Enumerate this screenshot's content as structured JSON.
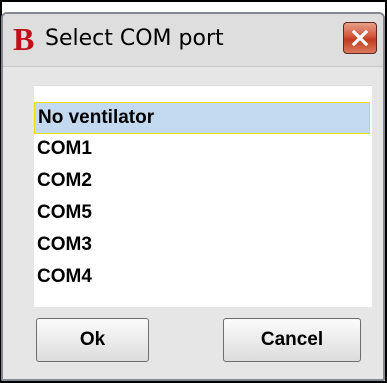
{
  "window": {
    "title": "Select COM port",
    "app_icon_letter": "B",
    "close_icon": "close-x-icon"
  },
  "port_list": {
    "selected_index": 0,
    "items": [
      {
        "label": "No ventilator"
      },
      {
        "label": "COM1"
      },
      {
        "label": "COM2"
      },
      {
        "label": "COM5"
      },
      {
        "label": "COM3"
      },
      {
        "label": "COM4"
      }
    ]
  },
  "buttons": {
    "ok_label": "Ok",
    "cancel_label": "Cancel"
  },
  "colors": {
    "selection_background": "#c3d9f0",
    "selection_border": "#e8e000",
    "close_button": "#c13b1f",
    "app_icon": "#c0101a"
  }
}
